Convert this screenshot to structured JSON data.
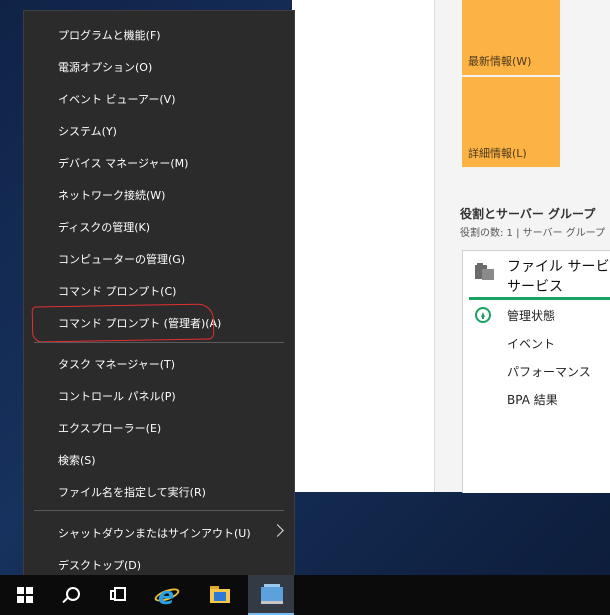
{
  "server_manager": {
    "tiles": [
      "最新情報(W)",
      "詳細情報(L)"
    ],
    "section_title": "役割とサーバー グループ",
    "section_subtitle": "役割の数: 1  |  サーバー グループ",
    "card": {
      "title_line1": "ファイル サービスと",
      "title_line2": "サービス",
      "rows": [
        "管理状態",
        "イベント",
        "パフォーマンス",
        "BPA 結果"
      ]
    }
  },
  "context_menu": {
    "groups": [
      [
        "プログラムと機能(F)",
        "電源オプション(O)",
        "イベント ビューアー(V)",
        "システム(Y)",
        "デバイス マネージャー(M)",
        "ネットワーク接続(W)",
        "ディスクの管理(K)",
        "コンピューターの管理(G)",
        "コマンド プロンプト(C)",
        "コマンド プロンプト (管理者)(A)"
      ],
      [
        "タスク マネージャー(T)",
        "コントロール パネル(P)",
        "エクスプローラー(E)",
        "検索(S)",
        "ファイル名を指定して実行(R)"
      ],
      [
        "シャットダウンまたはサインアウト(U)",
        "デスクトップ(D)"
      ]
    ],
    "highlighted_item": "コマンド プロンプト (管理者)(A)",
    "annotation_color": "#e53030"
  },
  "taskbar": {
    "icons": [
      "windows-start-icon",
      "search-icon",
      "task-view-icon",
      "internet-explorer-icon",
      "file-explorer-icon",
      "server-manager-icon"
    ]
  }
}
